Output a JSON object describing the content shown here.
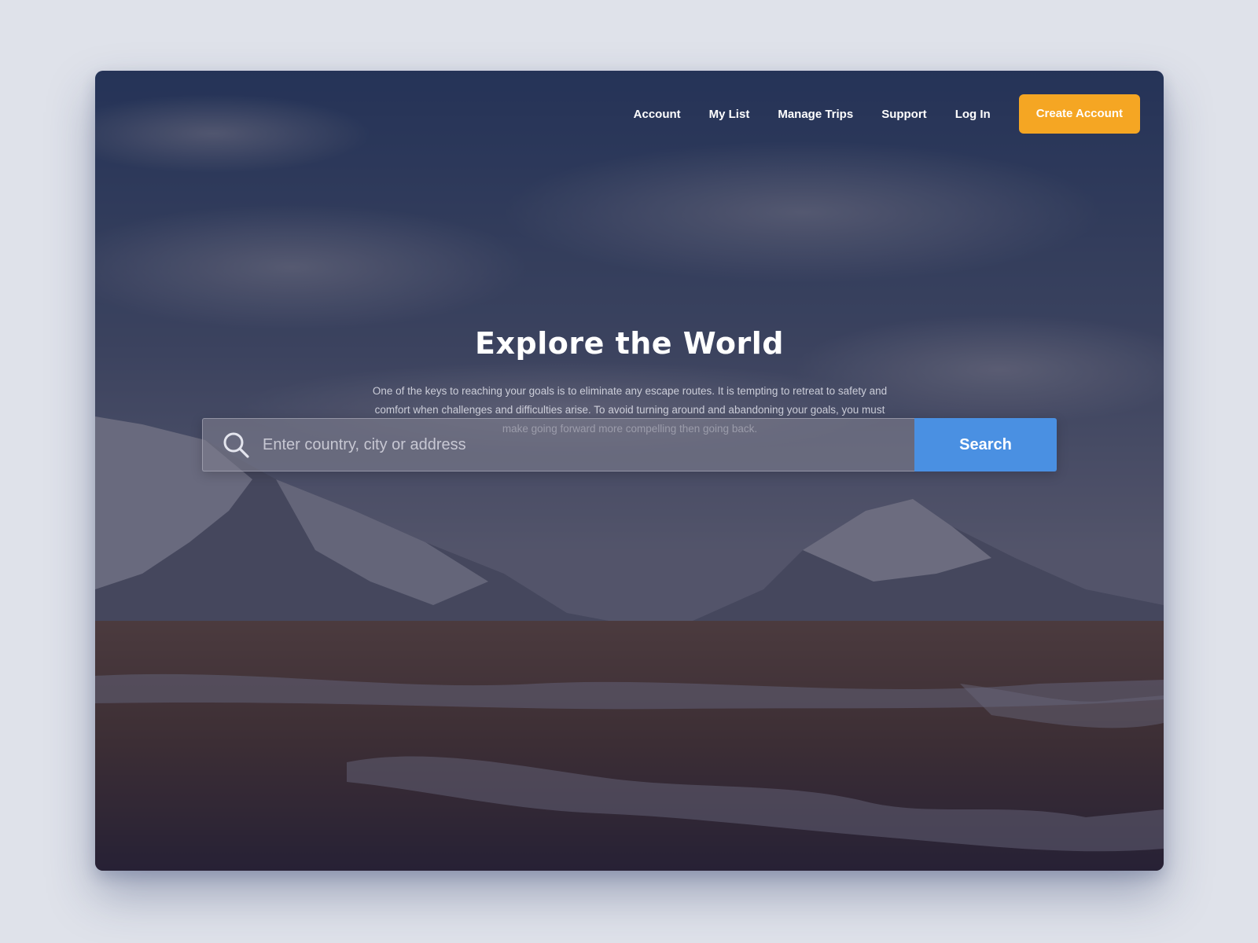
{
  "nav": {
    "items": [
      {
        "label": "Account"
      },
      {
        "label": "My List"
      },
      {
        "label": "Manage Trips"
      },
      {
        "label": "Support"
      },
      {
        "label": "Log In"
      }
    ],
    "cta_label": "Create Account"
  },
  "hero": {
    "title": "Explore the World",
    "description": "One of the keys to reaching your goals is to eliminate any escape routes. It is tempting to retreat to safety and comfort when challenges and difficulties arise. To avoid turning around and abandoning your goals, you must make going forward more compelling then going back."
  },
  "search": {
    "placeholder": "Enter country, city or address",
    "value": "",
    "button_label": "Search",
    "icon": "search-icon"
  },
  "colors": {
    "cta": "#f5a623",
    "search_button": "#4a90e2",
    "overlay": "#201e3a"
  }
}
